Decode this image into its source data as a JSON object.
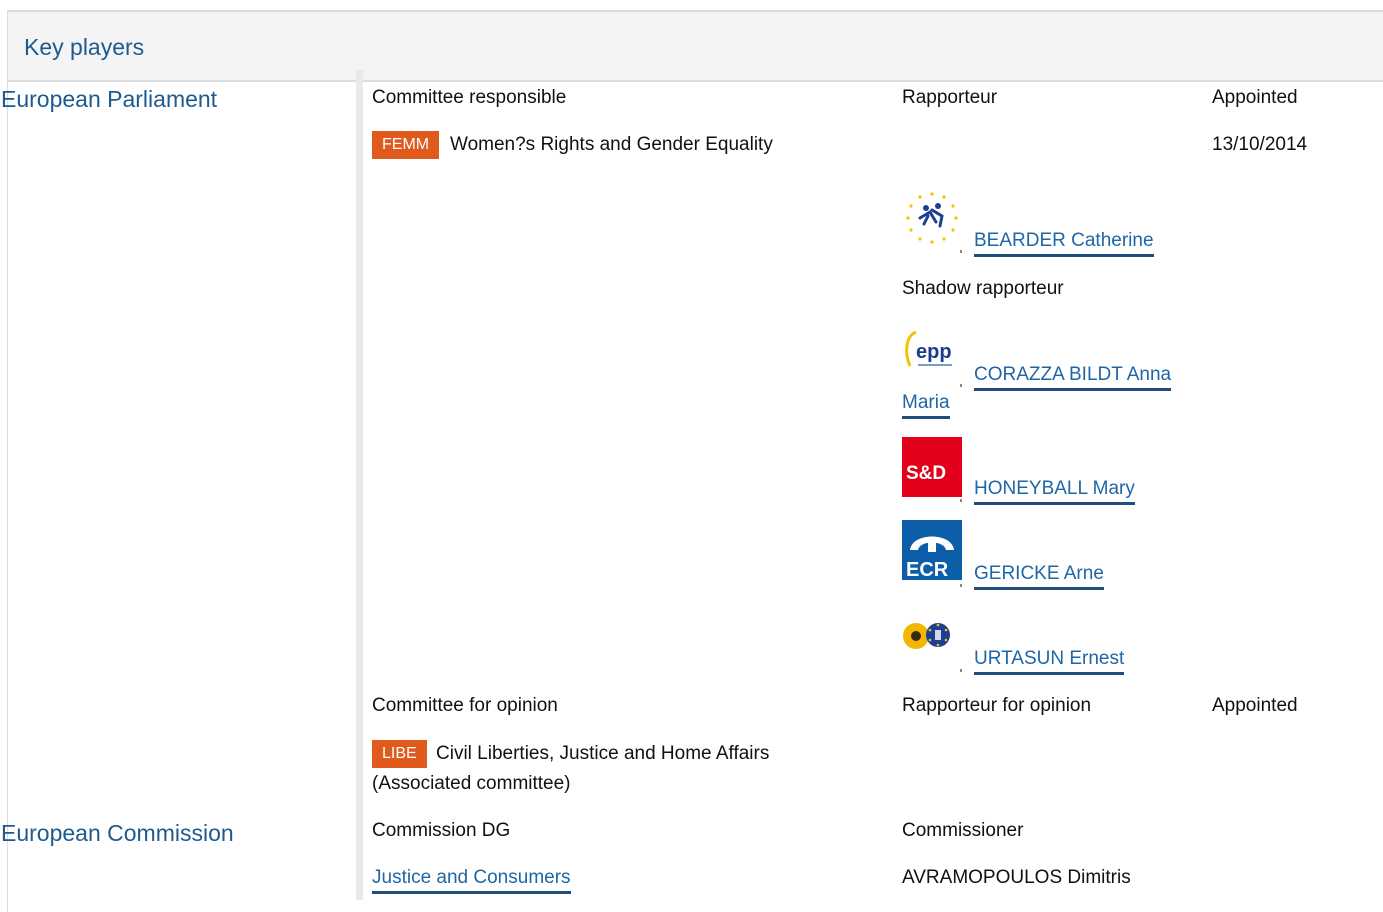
{
  "panel": {
    "title": "Key players"
  },
  "parliament": {
    "label": "European Parliament",
    "headers": {
      "committee": "Committee responsible",
      "rapporteur": "Rapporteur",
      "appointed": "Appointed"
    },
    "committee": {
      "code": "FEMM",
      "name": "Women?s Rights and Gender Equality",
      "appointed": "13/10/2014"
    },
    "rapporteur": {
      "name": "BEARDER Catherine",
      "group_icon": "alde-logo-icon"
    },
    "shadow_label": "Shadow rapporteur",
    "shadows": [
      {
        "name_line1": "CORAZZA BILDT Anna",
        "name_line2": "Maria",
        "group_icon": "epp-logo-icon",
        "logo_text": "epp"
      },
      {
        "name": "HONEYBALL Mary",
        "group_icon": "sd-logo-icon",
        "logo_text": "S&D"
      },
      {
        "name": "GERICKE Arne",
        "group_icon": "ecr-logo-icon",
        "logo_text": "ECR"
      },
      {
        "name": "URTASUN Ernest",
        "group_icon": "greens-efa-logo-icon"
      }
    ],
    "opinion_headers": {
      "committee": "Committee for opinion",
      "rapporteur": "Rapporteur for opinion",
      "appointed": "Appointed"
    },
    "opinion_committee": {
      "code": "LIBE",
      "name_line1": "Civil Liberties, Justice and Home Affairs",
      "name_line2": "(Associated committee)"
    }
  },
  "commission": {
    "label": "European Commission",
    "headers": {
      "dg": "Commission DG",
      "commissioner": "Commissioner"
    },
    "dg": "Justice and Consumers",
    "commissioner": "AVRAMOPOULOS Dimitris"
  },
  "colors": {
    "accent": "#1f5a8f",
    "link": "#1f66a6",
    "badge": "#e05a1e",
    "link_underline": "#1f4e7d"
  }
}
